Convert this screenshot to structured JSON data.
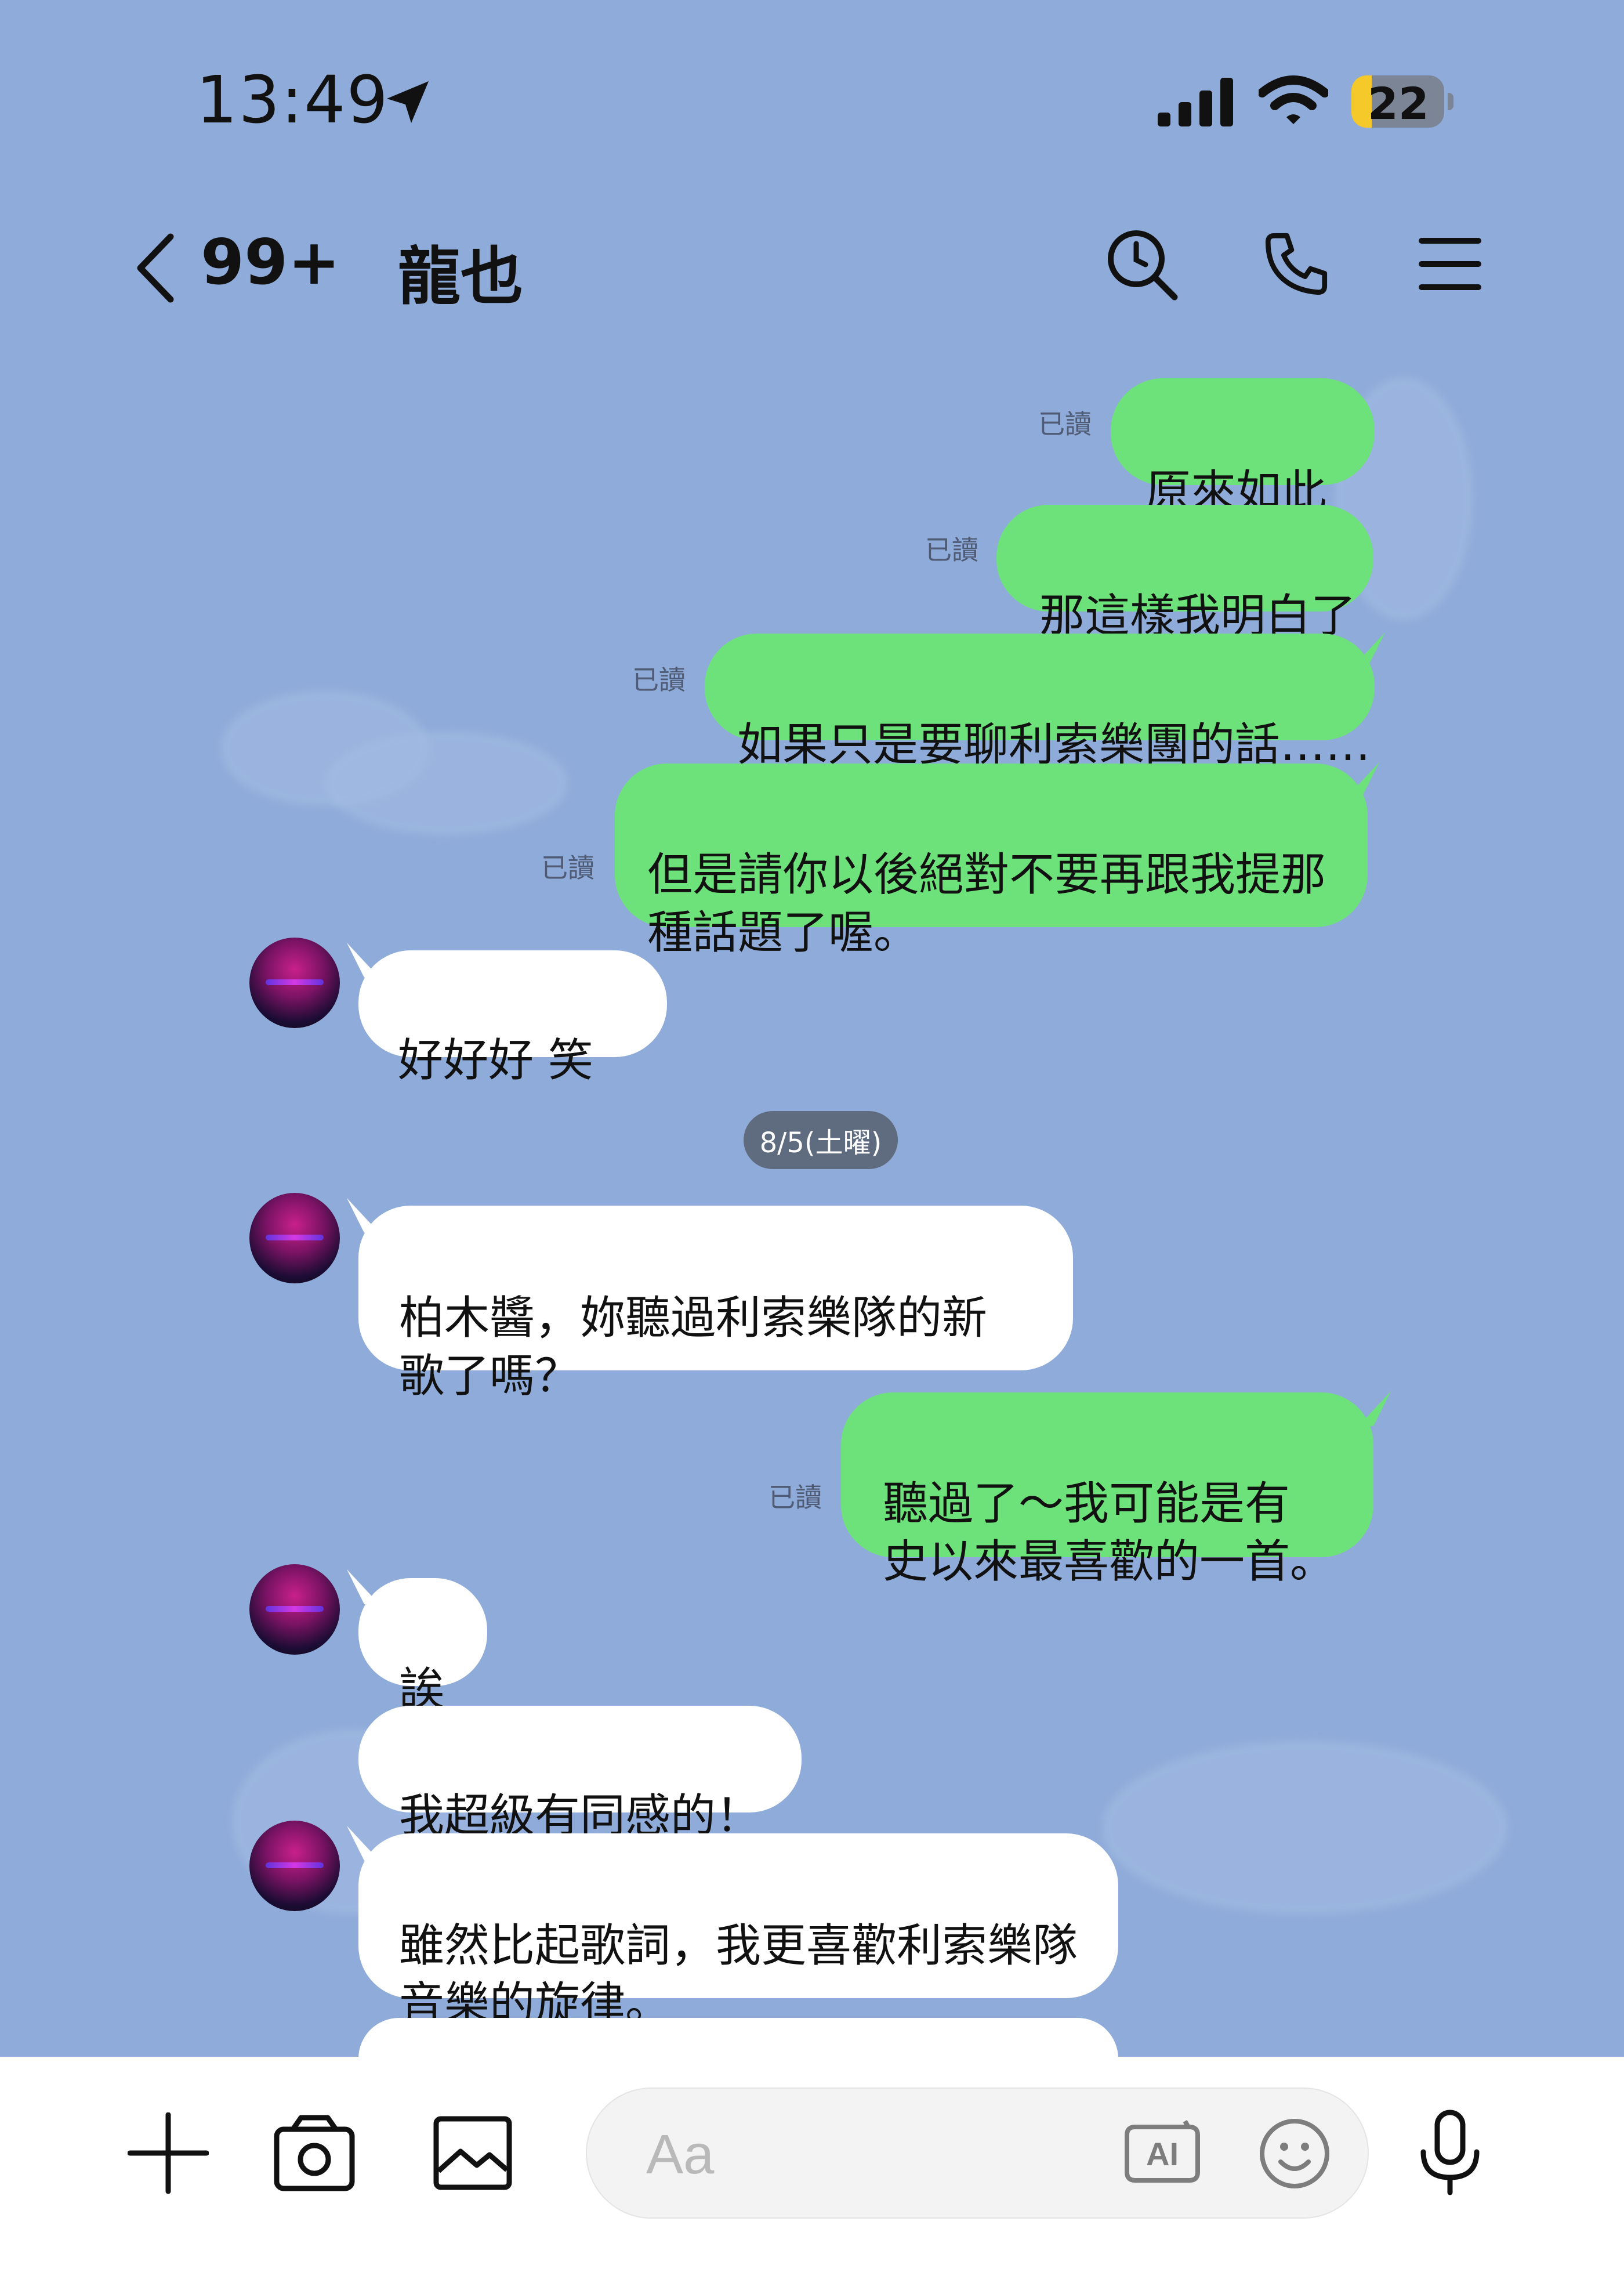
{
  "status_bar": {
    "time": "13:49",
    "battery": "22",
    "battery_level": 0.22
  },
  "header": {
    "unread_count": "99+",
    "title": "龍也"
  },
  "messages": [
    {
      "side": "out",
      "text": "原來如此",
      "read": "已讀"
    },
    {
      "side": "out",
      "text": "那這樣我明白了",
      "read": "已讀"
    },
    {
      "side": "out",
      "text": "如果只是要聊利索樂團的話……",
      "read": "已讀"
    },
    {
      "side": "out",
      "text": "但是請你以後絕對不要再跟我提那\n種話題了喔。",
      "read": "已讀"
    },
    {
      "side": "in",
      "text": "好好好 笑"
    },
    {
      "side": "in",
      "text": "柏木醬，妳聽過利索樂隊的新\n歌了嗎？"
    },
    {
      "side": "out",
      "text": "聽過了～我可能是有\n史以來最喜歡的一首。",
      "read": "已讀"
    },
    {
      "side": "in",
      "text": "誒"
    },
    {
      "side": "in",
      "text": "我超級有同感的！"
    },
    {
      "side": "in",
      "text": "雖然比起歌詞，我更喜歡利索樂隊\n音樂的旋律。"
    }
  ],
  "date_divider": "8/5(土曜)",
  "input": {
    "placeholder": "Aa"
  },
  "colors": {
    "background": "#8fabd9",
    "outgoing_bubble": "#6ee27a",
    "incoming_bubble": "#ffffff"
  },
  "icons": [
    "location-arrow-icon",
    "signal-icon",
    "wifi-icon",
    "battery-icon",
    "back-chevron-icon",
    "search-icon",
    "phone-icon",
    "menu-icon",
    "plus-icon",
    "camera-icon",
    "image-icon",
    "ai-icon",
    "emoji-icon",
    "microphone-icon"
  ]
}
